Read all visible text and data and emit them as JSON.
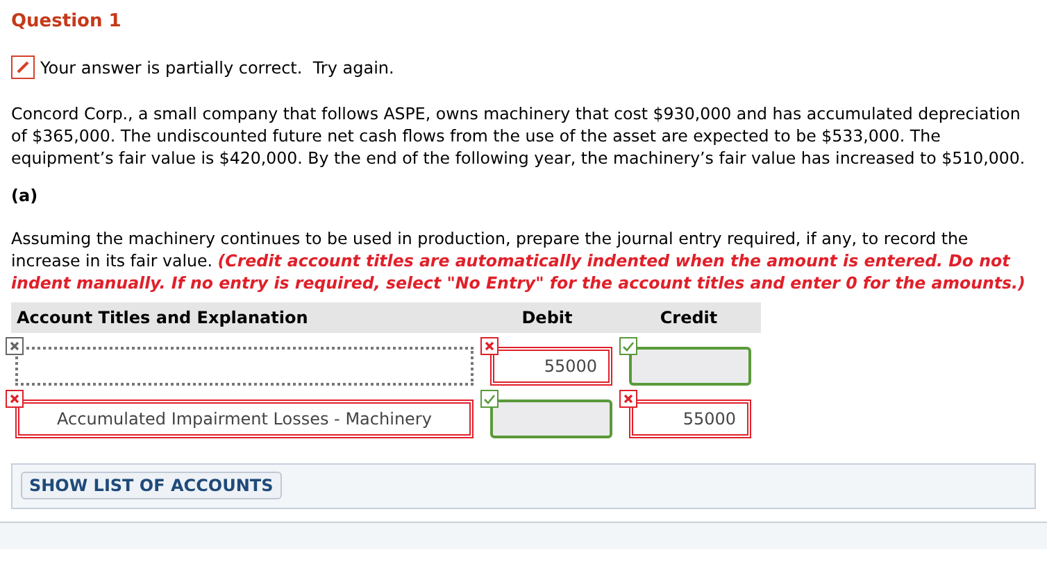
{
  "question": {
    "title": "Question 1"
  },
  "feedback": {
    "text": "Your answer is partially correct.  Try again."
  },
  "problem": {
    "text": "Concord Corp., a small company that follows ASPE, owns machinery that cost $930,000 and has accumulated depreciation of $365,000. The undiscounted future net cash flows from the use of the asset are expected to be $533,000. The equipment’s fair value is $420,000. By the end of the following year, the machinery’s fair value has increased to $510,000."
  },
  "part": {
    "label": "(a)"
  },
  "instructions": {
    "text": "Assuming the machinery continues to be used in production, prepare the journal entry required, if any, to record the increase in its fair value.",
    "note": "(Credit account titles are automatically indented when the amount is entered. Do not indent manually. If no entry is required, select \"No Entry\" for the account titles and enter 0 for the amounts.)"
  },
  "table": {
    "columns": [
      "Account Titles and Explanation",
      "Debit",
      "Credit"
    ],
    "entries": [
      {
        "account": {
          "kind": "unmarked"
        },
        "debit": {
          "kind": "wrong",
          "value": "55000"
        },
        "credit": {
          "kind": "correct"
        }
      },
      {
        "account": {
          "kind": "wrong",
          "value": "Accumulated Impairment Losses - Machinery"
        },
        "debit": {
          "kind": "correct"
        },
        "credit": {
          "kind": "wrong",
          "value": "55000"
        }
      }
    ]
  },
  "accounts_button": {
    "label": "SHOW LIST OF ACCOUNTS"
  }
}
